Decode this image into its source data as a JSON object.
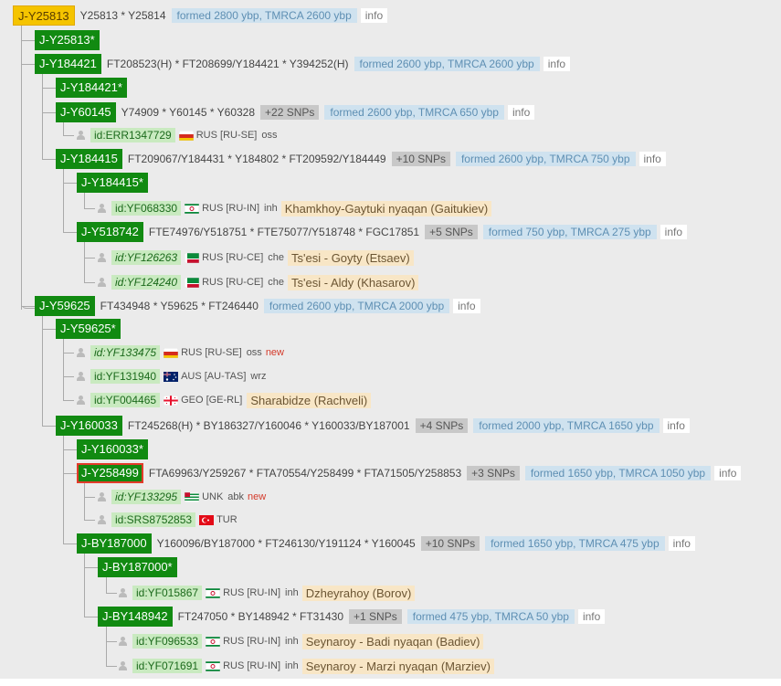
{
  "tree": {
    "root": {
      "label": "J-Y25813",
      "snps": "Y25813 * Y25814",
      "formed": "formed 2800 ybp, TMRCA 2600 ybp",
      "info": "info"
    },
    "n_y25813s": {
      "label": "J-Y25813*"
    },
    "n_y184421": {
      "label": "J-Y184421",
      "snps": "FT208523(H) * FT208699/Y184421 * Y394252(H)",
      "formed": "formed 2600 ybp, TMRCA 2600 ybp",
      "info": "info"
    },
    "n_y184421s": {
      "label": "J-Y184421*"
    },
    "n_y60145": {
      "label": "J-Y60145",
      "snps": "Y74909 * Y60145 * Y60328",
      "count": "+22 SNPs",
      "formed": "formed 2600 ybp, TMRCA 650 ybp",
      "info": "info"
    },
    "s_err1347729": {
      "id": "id:ERR1347729",
      "cc": "RUS [RU-SE]",
      "grp": "oss"
    },
    "n_y184415": {
      "label": "J-Y184415",
      "snps": "FT209067/Y184431 * Y184802 * FT209592/Y184449",
      "count": "+10 SNPs",
      "formed": "formed 2600 ybp, TMRCA 750 ybp",
      "info": "info"
    },
    "n_y184415s": {
      "label": "J-Y184415*"
    },
    "s_yf068330": {
      "id": "id:YF068330",
      "cc": "RUS [RU-IN]",
      "grp": "inh",
      "surname": "Khamkhoy-Gaytuki nyaqan (Gaitukiev)"
    },
    "n_y518742": {
      "label": "J-Y518742",
      "snps": "FTE74976/Y518751 * FTE75077/Y518748 * FGC17851",
      "count": "+5 SNPs",
      "formed": "formed 750 ybp, TMRCA 275 ybp",
      "info": "info"
    },
    "s_yf126263": {
      "id": "id:YF126263",
      "cc": "RUS [RU-CE]",
      "grp": "che",
      "surname": "Ts'esi - Goyty (Etsaev)"
    },
    "s_yf124240": {
      "id": "id:YF124240",
      "cc": "RUS [RU-CE]",
      "grp": "che",
      "surname": "Ts'esi - Aldy (Khasarov)"
    },
    "n_y59625": {
      "label": "J-Y59625",
      "snps": "FT434948 * Y59625 * FT246440",
      "formed": "formed 2600 ybp, TMRCA 2000 ybp",
      "info": "info"
    },
    "n_y59625s": {
      "label": "J-Y59625*"
    },
    "s_yf133475": {
      "id": "id:YF133475",
      "cc": "RUS [RU-SE]",
      "grp": "oss",
      "new": "new"
    },
    "s_yf131940": {
      "id": "id:YF131940",
      "cc": "AUS [AU-TAS]",
      "grp": "wrz"
    },
    "s_yf004465": {
      "id": "id:YF004465",
      "cc": "GEO [GE-RL]",
      "surname": "Sharabidze (Rachveli)"
    },
    "n_y160033": {
      "label": "J-Y160033",
      "snps": "FT245268(H) * BY186327/Y160046 * Y160033/BY187001",
      "count": "+4 SNPs",
      "formed": "formed 2000 ybp, TMRCA 1650 ybp",
      "info": "info"
    },
    "n_y160033s": {
      "label": "J-Y160033*"
    },
    "n_y258499": {
      "label": "J-Y258499",
      "snps": "FTA69963/Y259267 * FTA70554/Y258499 * FTA71505/Y258853",
      "count": "+3 SNPs",
      "formed": "formed 1650 ybp, TMRCA 1050 ybp",
      "info": "info"
    },
    "s_yf133295": {
      "id": "id:YF133295",
      "cc": "UNK",
      "grp": "abk",
      "new": "new"
    },
    "s_srs8752853": {
      "id": "id:SRS8752853",
      "cc": "TUR"
    },
    "n_by187000": {
      "label": "J-BY187000",
      "snps": "Y160096/BY187000 * FT246130/Y191124 * Y160045",
      "count": "+10 SNPs",
      "formed": "formed 1650 ybp, TMRCA 475 ybp",
      "info": "info"
    },
    "n_by187000s": {
      "label": "J-BY187000*"
    },
    "s_yf015867": {
      "id": "id:YF015867",
      "cc": "RUS [RU-IN]",
      "grp": "inh",
      "surname": "Dzheyrahoy (Borov)"
    },
    "n_by148942": {
      "label": "J-BY148942",
      "snps": "FT247050 * BY148942 * FT31430",
      "count": "+1 SNPs",
      "formed": "formed 475 ybp, TMRCA 50 ybp",
      "info": "info"
    },
    "s_yf096533": {
      "id": "id:YF096533",
      "cc": "RUS [RU-IN]",
      "grp": "inh",
      "surname": "Seynaroy - Badi nyaqan (Badiev)"
    },
    "s_yf071691": {
      "id": "id:YF071691",
      "cc": "RUS [RU-IN]",
      "grp": "inh",
      "surname": "Seynaroy - Marzi nyaqan (Marziev)"
    }
  },
  "flags": {
    "rus_se": "north-ossetia-flag",
    "rus_in": "ingushetia-flag",
    "rus_ce": "chechnya-flag",
    "aus": "australia-flag",
    "geo": "georgia-flag",
    "unk": "abkhazia-flag",
    "tur": "turkey-flag"
  },
  "colors": {
    "node_bg": "#118a11",
    "root_bg": "#f5c400",
    "formed_bg": "#cfe2ef",
    "sample_bg": "#c9eac0",
    "surname_bg": "#f8e6c6",
    "new_text": "#d43a2a",
    "highlight_outline": "#e23a2a"
  }
}
